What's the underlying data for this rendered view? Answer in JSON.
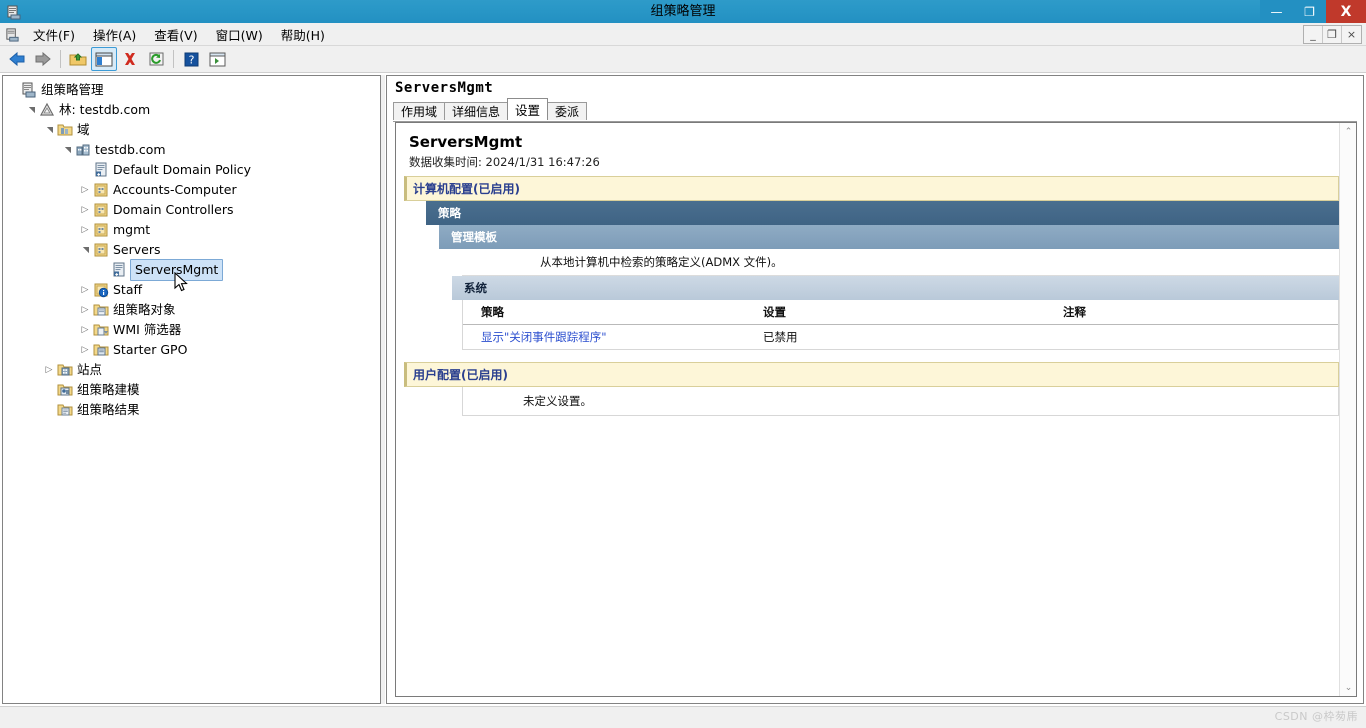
{
  "window": {
    "title": "组策略管理",
    "icon": "gpmc-icon",
    "controls": {
      "minimize": "—",
      "maximize": "❐",
      "close": "X"
    }
  },
  "mdi_controls": {
    "minimize": "_",
    "restore": "❐",
    "close": "×"
  },
  "menubar": {
    "icon": "console-icon",
    "items": [
      {
        "label": "文件(F)",
        "name": "menu-file"
      },
      {
        "label": "操作(A)",
        "name": "menu-action"
      },
      {
        "label": "查看(V)",
        "name": "menu-view"
      },
      {
        "label": "窗口(W)",
        "name": "menu-window"
      },
      {
        "label": "帮助(H)",
        "name": "menu-help"
      }
    ]
  },
  "toolbar": {
    "buttons": [
      {
        "name": "back-icon",
        "glyph": "back"
      },
      {
        "name": "forward-icon",
        "glyph": "forward"
      },
      {
        "name": "up-folder-icon",
        "glyph": "upfolder"
      },
      {
        "name": "show-hide-tree-icon",
        "glyph": "window",
        "selected": true
      },
      {
        "name": "delete-icon",
        "glyph": "delete"
      },
      {
        "name": "refresh-icon",
        "glyph": "refresh"
      },
      {
        "name": "help-icon",
        "glyph": "help"
      },
      {
        "name": "export-list-icon",
        "glyph": "list"
      }
    ]
  },
  "tree": {
    "nodes": [
      {
        "label": "组策略管理",
        "indent": 0,
        "twist": "none",
        "icon": "console-root-icon",
        "selected": false
      },
      {
        "label": "林: testdb.com",
        "indent": 1,
        "twist": "open",
        "icon": "forest-icon",
        "selected": false
      },
      {
        "label": "域",
        "indent": 2,
        "twist": "open",
        "icon": "domains-folder-icon",
        "selected": false
      },
      {
        "label": "testdb.com",
        "indent": 3,
        "twist": "open",
        "icon": "domain-icon",
        "selected": false
      },
      {
        "label": "Default Domain Policy",
        "indent": 4,
        "twist": "none",
        "icon": "gpo-link-icon",
        "selected": false
      },
      {
        "label": "Accounts-Computer",
        "indent": 4,
        "twist": "closed",
        "icon": "ou-icon",
        "selected": false
      },
      {
        "label": "Domain Controllers",
        "indent": 4,
        "twist": "closed",
        "icon": "ou-icon",
        "selected": false
      },
      {
        "label": "mgmt",
        "indent": 4,
        "twist": "closed",
        "icon": "ou-icon",
        "selected": false
      },
      {
        "label": "Servers",
        "indent": 4,
        "twist": "open",
        "icon": "ou-icon",
        "selected": false
      },
      {
        "label": "ServersMgmt",
        "indent": 5,
        "twist": "none",
        "icon": "gpo-link-icon",
        "selected": true
      },
      {
        "label": "Staff",
        "indent": 4,
        "twist": "closed",
        "icon": "ou-blocked-icon",
        "selected": false
      },
      {
        "label": "组策略对象",
        "indent": 4,
        "twist": "closed",
        "icon": "gpo-container-icon",
        "selected": false
      },
      {
        "label": "WMI 筛选器",
        "indent": 4,
        "twist": "closed",
        "icon": "wmi-filter-icon",
        "selected": false
      },
      {
        "label": "Starter GPO",
        "indent": 4,
        "twist": "closed",
        "icon": "starter-gpo-icon",
        "selected": false
      },
      {
        "label": "站点",
        "indent": 2,
        "twist": "closed",
        "icon": "sites-icon",
        "selected": false
      },
      {
        "label": "组策略建模",
        "indent": 2,
        "twist": "none",
        "icon": "modeling-icon",
        "selected": false
      },
      {
        "label": "组策略结果",
        "indent": 2,
        "twist": "none",
        "icon": "results-icon",
        "selected": false
      }
    ]
  },
  "right_pane": {
    "title": "ServersMgmt",
    "tabs": [
      {
        "label": "作用域",
        "active": false,
        "name": "tab-scope"
      },
      {
        "label": "详细信息",
        "active": false,
        "name": "tab-details"
      },
      {
        "label": "设置",
        "active": true,
        "name": "tab-settings"
      },
      {
        "label": "委派",
        "active": false,
        "name": "tab-delegation"
      }
    ]
  },
  "report": {
    "heading": "ServersMgmt",
    "collected": "数据收集时间: 2024/1/31 16:47:26",
    "computer_section": {
      "title": "计算机配置(已启用)",
      "policies_label": "策略",
      "admin_templates_label": "管理模板",
      "admx_note": "从本地计算机中检索的策略定义(ADMX 文件)。",
      "system_label": "系统",
      "table": {
        "columns": [
          "策略",
          "设置",
          "注释"
        ],
        "rows": [
          {
            "policy": "显示\"关闭事件跟踪程序\"",
            "setting": "已禁用",
            "comment": ""
          }
        ]
      }
    },
    "user_section": {
      "title": "用户配置(已启用)",
      "note": "未定义设置。"
    },
    "scrollbar": {
      "up": "⌃",
      "down": "⌄"
    }
  },
  "watermark": "CSDN @枠茐乕",
  "colors": {
    "title_bar": "#2390c2",
    "close_button": "#c0392b",
    "section_yellow_bg": "#fdf6d8",
    "section_heading_text": "#2a3f8f",
    "row_dark": "#42688a",
    "row_mid": "#87a5c0",
    "row_sub": "#c3d1df",
    "link": "#2c4fcf",
    "selection": "#cde2f7"
  }
}
